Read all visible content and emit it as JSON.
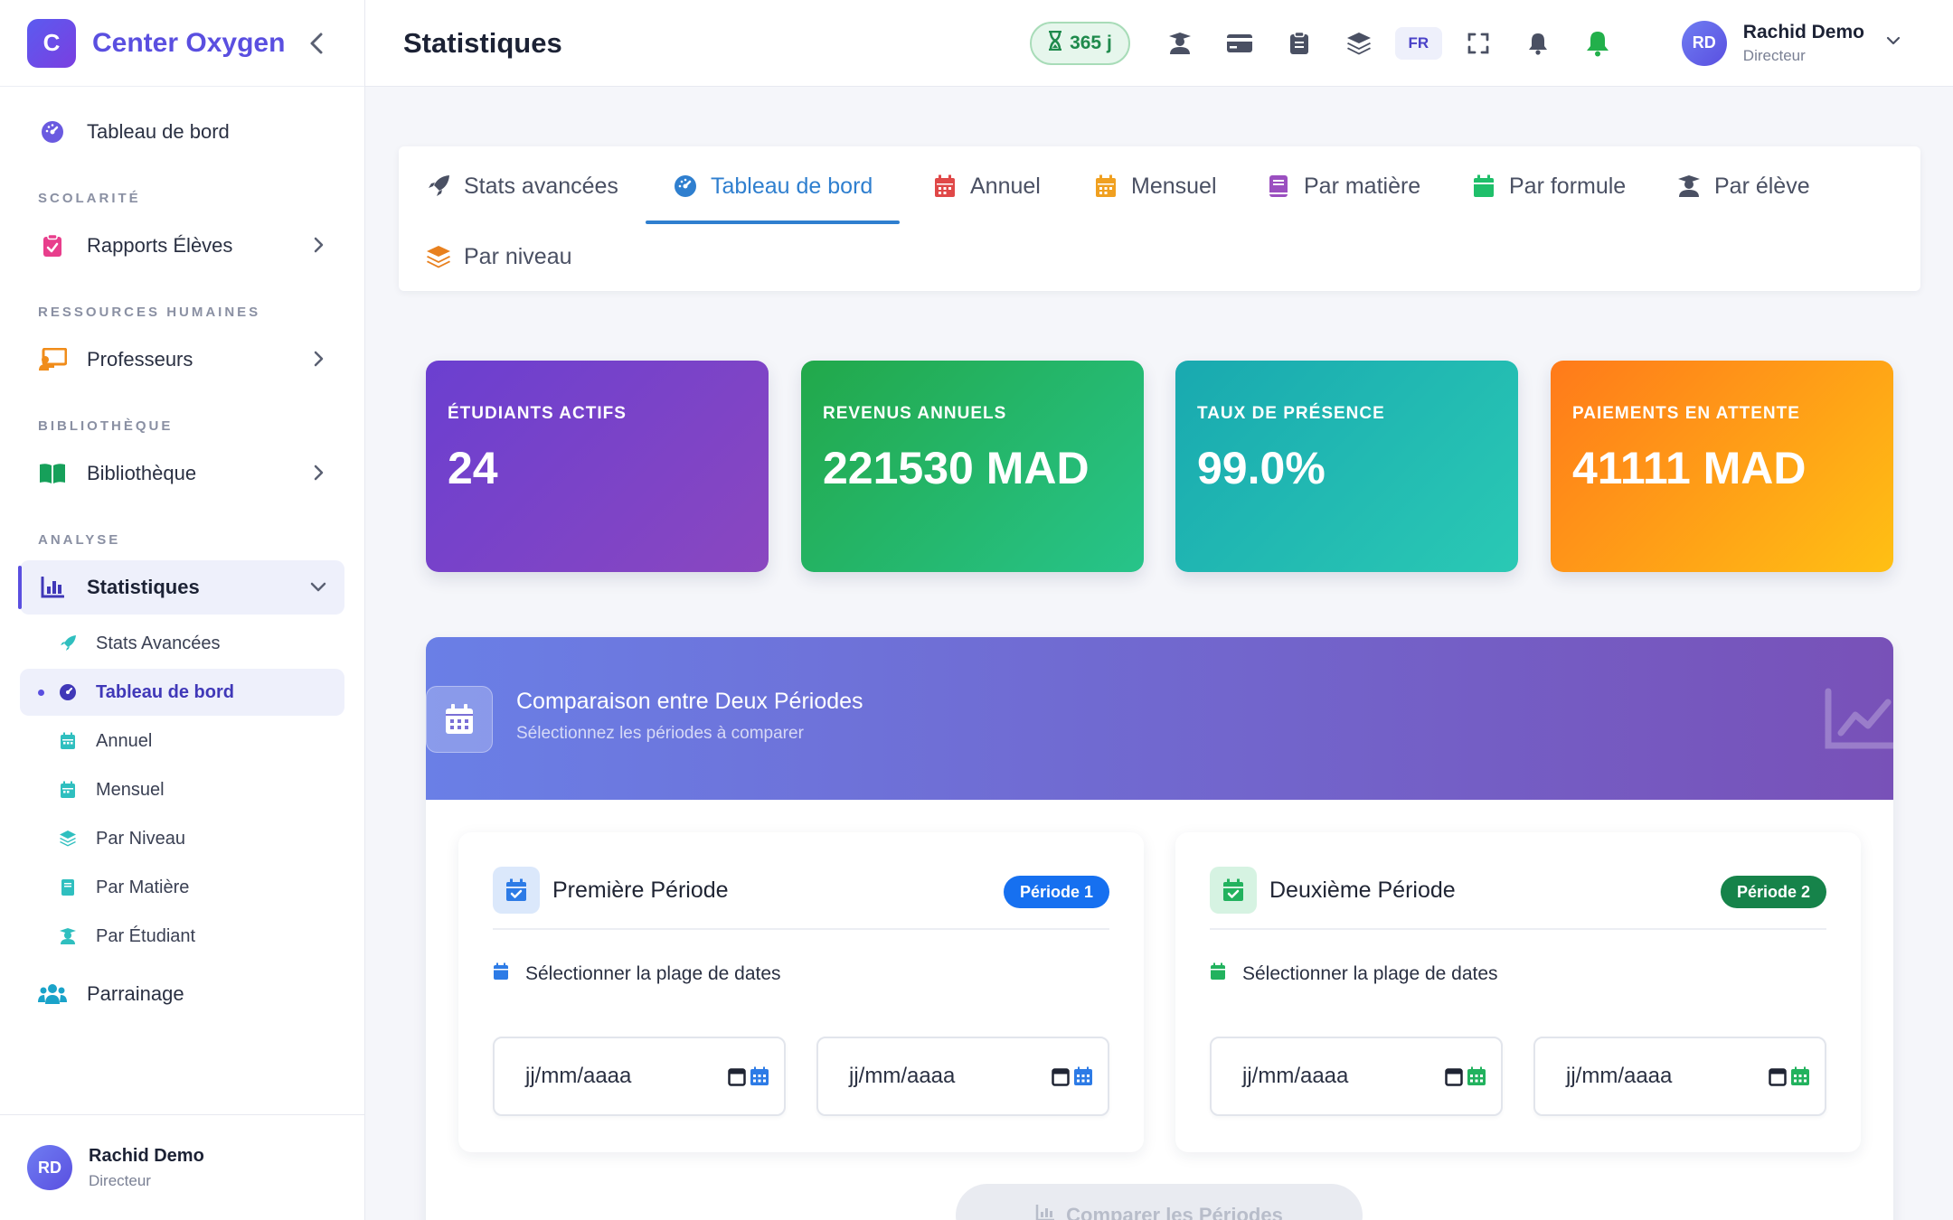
{
  "brand": {
    "logo_letter": "C",
    "name": "Center Oxygen"
  },
  "sidebar": {
    "dashboard_label": "Tableau de bord",
    "sections": {
      "scolarite": "SCOLARITÉ",
      "rh": "RESSOURCES HUMAINES",
      "bibliotheque": "BIBLIOTHÈQUE",
      "analyse": "ANALYSE"
    },
    "rapports_label": "Rapports Élèves",
    "professeurs_label": "Professeurs",
    "bibliotheque_label": "Bibliothèque",
    "statistiques_label": "Statistiques",
    "stats_sub": [
      {
        "label": "Stats Avancées"
      },
      {
        "label": "Tableau de bord"
      },
      {
        "label": "Annuel"
      },
      {
        "label": "Mensuel"
      },
      {
        "label": "Par Niveau"
      },
      {
        "label": "Par Matière"
      },
      {
        "label": "Par Étudiant"
      }
    ],
    "parrainage_label": "Parrainage",
    "footer": {
      "initials": "RD",
      "name": "Rachid Demo",
      "role": "Directeur"
    }
  },
  "topbar": {
    "title": "Statistiques",
    "days_badge": "365 j",
    "lang": "FR",
    "user": {
      "initials": "RD",
      "name": "Rachid Demo",
      "role": "Directeur"
    }
  },
  "tabs": [
    {
      "label": "Stats avancées"
    },
    {
      "label": "Tableau de bord"
    },
    {
      "label": "Annuel"
    },
    {
      "label": "Mensuel"
    },
    {
      "label": "Par matière"
    },
    {
      "label": "Par formule"
    },
    {
      "label": "Par élève"
    },
    {
      "label": "Par niveau"
    }
  ],
  "stats": [
    {
      "label": "ÉTUDIANTS ACTIFS",
      "value": "24"
    },
    {
      "label": "REVENUS ANNUELS",
      "value": "221530 MAD"
    },
    {
      "label": "TAUX DE PRÉSENCE",
      "value": "99.0%"
    },
    {
      "label": "PAIEMENTS EN ATTENTE",
      "value": "41111 MAD"
    }
  ],
  "comparison": {
    "title": "Comparaison entre Deux Périodes",
    "subtitle": "Sélectionnez les périodes à comparer",
    "period1": {
      "title": "Première Période",
      "badge": "Période 1",
      "range_label": "Sélectionner la plage de dates",
      "start_placeholder": "jj/mm/aaaa",
      "end_placeholder": "jj/mm/aaaa"
    },
    "period2": {
      "title": "Deuxième Période",
      "badge": "Période 2",
      "range_label": "Sélectionner la plage de dates",
      "start_placeholder": "jj/mm/aaaa",
      "end_placeholder": "jj/mm/aaaa"
    },
    "compare_button": "Comparer les Périodes"
  },
  "colors": {
    "brand": "#5a4fe0",
    "tab_active": "#2f7fcf",
    "period1": "#1670f0",
    "period2": "#16834a"
  }
}
